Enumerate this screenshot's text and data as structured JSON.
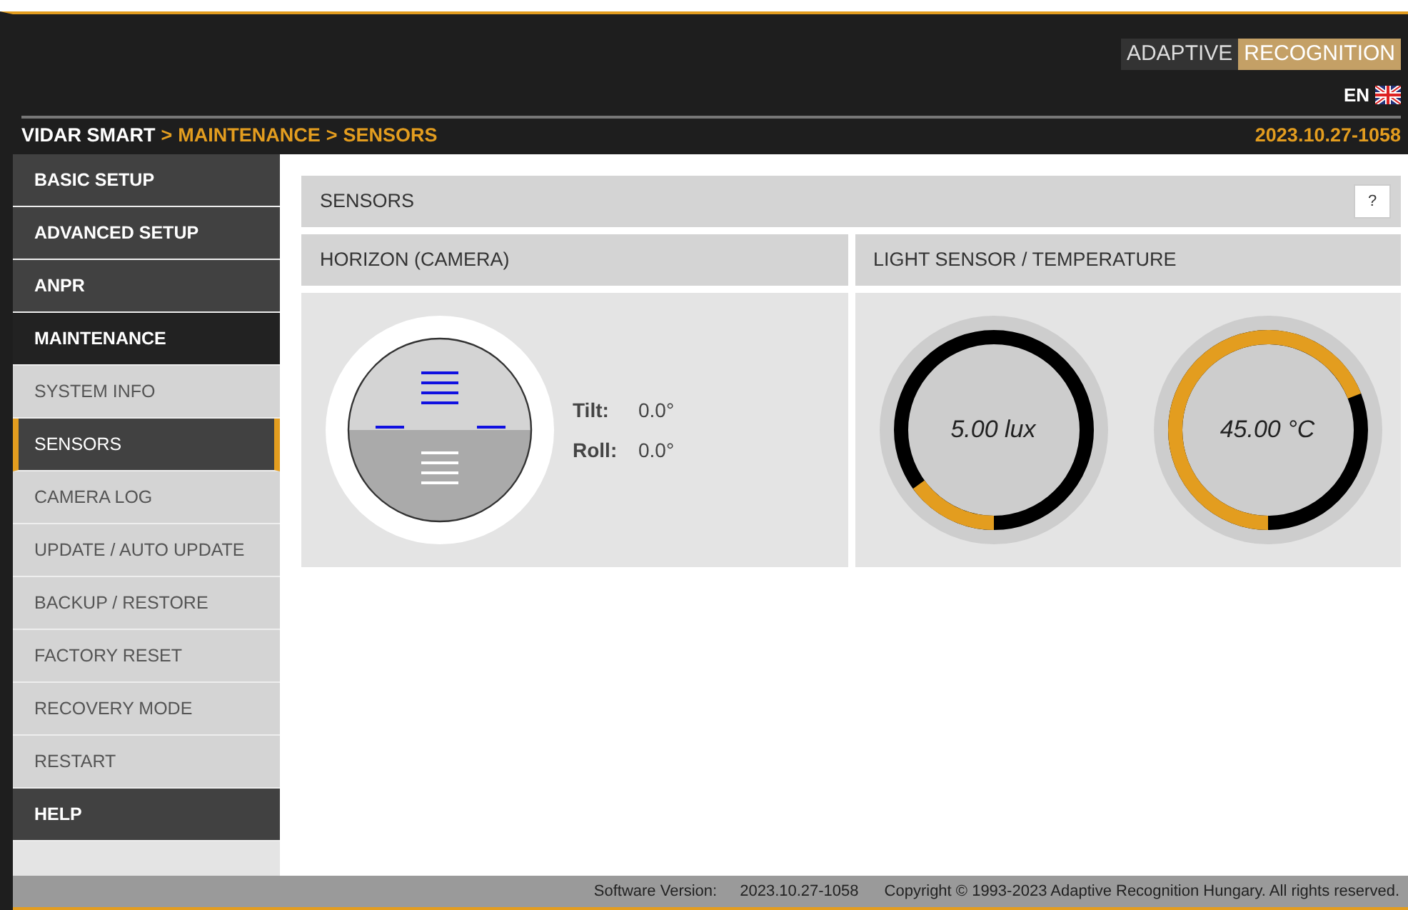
{
  "header": {
    "logo": {
      "left": "ADAPTIVE",
      "right": "RECOGNITION"
    },
    "language": "EN",
    "breadcrumb": [
      {
        "kind": "root",
        "label": "VIDAR SMART"
      },
      {
        "kind": "sep",
        "label": ">"
      },
      {
        "kind": "page",
        "label": "MAINTENANCE"
      },
      {
        "kind": "sep",
        "label": ">"
      },
      {
        "kind": "page",
        "label": "SENSORS"
      }
    ],
    "version": "2023.10.27-1058"
  },
  "sidebar": {
    "items": [
      {
        "label": "BASIC SETUP",
        "selected": false
      },
      {
        "label": "ADVANCED SETUP",
        "selected": false
      },
      {
        "label": "ANPR",
        "selected": false
      },
      {
        "label": "MAINTENANCE",
        "selected": true,
        "children": [
          {
            "label": "SYSTEM INFO",
            "selected": false
          },
          {
            "label": "SENSORS",
            "selected": true
          },
          {
            "label": "CAMERA LOG",
            "selected": false
          },
          {
            "label": "UPDATE / AUTO UPDATE",
            "selected": false
          },
          {
            "label": "BACKUP / RESTORE",
            "selected": false
          },
          {
            "label": "FACTORY RESET",
            "selected": false
          },
          {
            "label": "RECOVERY MODE",
            "selected": false
          },
          {
            "label": "RESTART",
            "selected": false
          }
        ]
      },
      {
        "label": "HELP",
        "selected": false
      }
    ]
  },
  "page": {
    "title": "SENSORS",
    "help_button": "?",
    "panels": [
      {
        "kind": "horizon",
        "title": "HORIZON (CAMERA)",
        "readings": [
          {
            "label": "Tilt:",
            "value": "0.0°"
          },
          {
            "label": "Roll:",
            "value": "0.0°"
          }
        ]
      },
      {
        "kind": "gauges",
        "title": "LIGHT SENSOR / TEMPERATURE",
        "gauges": [
          {
            "reading": "5.00 lux",
            "level": 0.15
          },
          {
            "reading": "45.00 °C",
            "level": 0.69
          }
        ]
      }
    ]
  },
  "footer": {
    "version_label": "Software Version:",
    "version": "2023.10.27-1058",
    "copyright": "Copyright © 1993-2023 Adaptive Recognition Hungary. All rights reserved."
  }
}
